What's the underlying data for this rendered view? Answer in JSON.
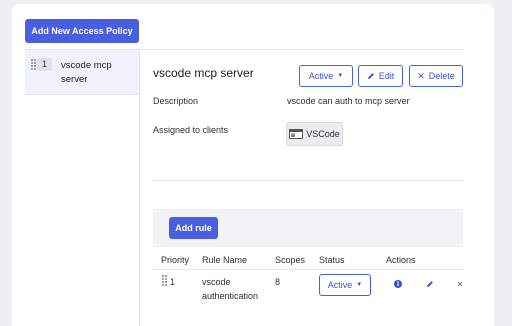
{
  "toolbar": {
    "add_policy_label": "Add New Access Policy"
  },
  "sidebar": {
    "items": [
      {
        "priority": "1",
        "name": "vscode mcp server"
      }
    ]
  },
  "detail": {
    "title": "vscode mcp server",
    "status_label": "Active",
    "edit_label": "Edit",
    "delete_label": "Delete",
    "description_label": "Description",
    "description_value": "vscode can auth to mcp server",
    "assigned_label": "Assigned to clients",
    "client_name": "VSCode"
  },
  "rules": {
    "add_rule_label": "Add rule",
    "headers": {
      "priority": "Priority",
      "rule_name": "Rule Name",
      "scopes": "Scopes",
      "status": "Status",
      "actions": "Actions"
    },
    "rows": [
      {
        "priority": "1",
        "name": "vscode authentication",
        "scopes": "8",
        "status": "Active"
      }
    ]
  },
  "icons": {
    "pencil": "pencil-icon",
    "close": "close-icon",
    "info": "info-icon",
    "caret": "caret-down-icon",
    "drag": "drag-handle-icon",
    "client": "app-icon"
  },
  "colors": {
    "accent": "#4a5fe0",
    "selected_bg": "#eff1fc",
    "panel_bg": "#f1f2f4"
  }
}
